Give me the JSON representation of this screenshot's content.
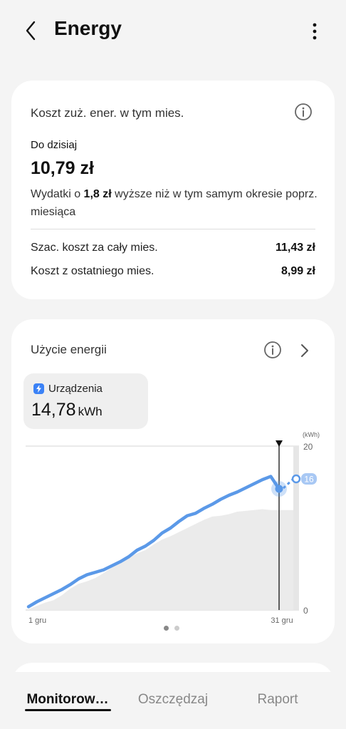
{
  "header": {
    "title": "Energy"
  },
  "cost_card": {
    "title": "Koszt zuż. ener. w tym mies.",
    "to_date_label": "Do dzisiaj",
    "to_date_value": "10,79 zł",
    "compare_prefix": "Wydatki o ",
    "compare_amount": "1,8 zł",
    "compare_suffix": " wyższe niż w tym samym okresie poprz. miesiąca",
    "rows": [
      {
        "label": "Szac. koszt za cały mies.",
        "value": "11,43 zł"
      },
      {
        "label": "Koszt z ostatniego mies.",
        "value": "8,99 zł"
      }
    ]
  },
  "energy_card": {
    "title": "Użycie energii",
    "device_label": "Urządzenia",
    "device_value": "14,78",
    "device_unit": "kWh"
  },
  "chart_data": {
    "type": "line",
    "unit_label": "(kWh)",
    "ylim": [
      0,
      20
    ],
    "y_ticks": [
      "20",
      "0"
    ],
    "x_labels": [
      "1 gru",
      "31 gru"
    ],
    "current_series": {
      "x": [
        1,
        2,
        3,
        4,
        5,
        6,
        7,
        8,
        9,
        10,
        11,
        12,
        13,
        14,
        15,
        16,
        17,
        18,
        19,
        20,
        21,
        22,
        23,
        24,
        25,
        26,
        27,
        28,
        29,
        30,
        31
      ],
      "y": [
        0.4,
        1.0,
        1.5,
        2.0,
        2.5,
        3.1,
        3.8,
        4.3,
        4.6,
        4.9,
        5.4,
        5.9,
        6.5,
        7.3,
        7.8,
        8.5,
        9.4,
        10.0,
        10.8,
        11.5,
        11.8,
        12.4,
        12.9,
        13.5,
        14.0,
        14.4,
        14.9,
        15.4,
        15.9,
        16.3,
        14.78
      ]
    },
    "projection_label": "16",
    "projection_value": 16.0,
    "previous_series_y": [
      0.1,
      0.5,
      0.9,
      1.2,
      1.8,
      2.6,
      3.2,
      3.5,
      3.9,
      4.5,
      5.2,
      5.8,
      6.4,
      6.9,
      7.3,
      8.0,
      8.6,
      9.0,
      9.5,
      10.0,
      10.5,
      11.0,
      11.4,
      11.5,
      11.7,
      12.0,
      12.1,
      12.2,
      12.3,
      12.2,
      12.2
    ],
    "colors": {
      "current": "#5b99e8",
      "previous": "#ebebeb",
      "marker": "#111111"
    }
  },
  "pager": {
    "pages": 2,
    "active": 0
  },
  "tabs": [
    {
      "label": "Monitorow…"
    },
    {
      "label": "Oszczędzaj"
    },
    {
      "label": "Raport"
    }
  ]
}
